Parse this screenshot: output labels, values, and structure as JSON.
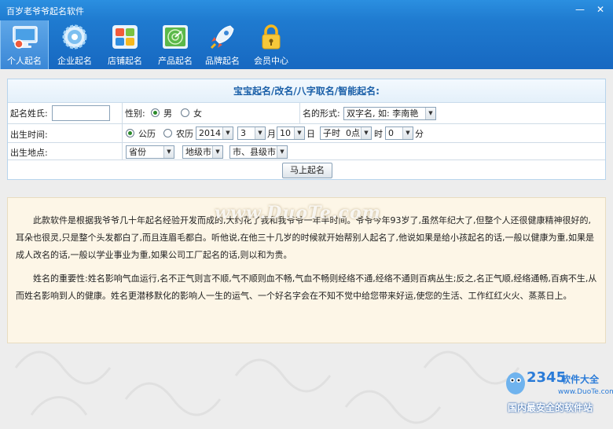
{
  "window": {
    "title": "百岁老爷爷起名软件",
    "min": "—",
    "close": "✕"
  },
  "toolbar": {
    "items": [
      {
        "label": "个人起名",
        "icon": "monitor-icon",
        "active": true
      },
      {
        "label": "企业起名",
        "icon": "gear-icon"
      },
      {
        "label": "店铺起名",
        "icon": "tiles-icon"
      },
      {
        "label": "产品起名",
        "icon": "radar-icon"
      },
      {
        "label": "品牌起名",
        "icon": "rocket-icon"
      },
      {
        "label": "会员中心",
        "icon": "lock-icon"
      }
    ]
  },
  "form": {
    "header": "宝宝起名/改名/八字取名/智能起名:",
    "surname_label": "起名姓氏:",
    "surname_value": "",
    "gender_label": "性别:",
    "gender_male": "男",
    "gender_female": "女",
    "gender_selected": "男",
    "name_form_label": "名的形式:",
    "name_form_value": "双字名, 如: 李南艳",
    "birth_time_label": "出生时间:",
    "solar_label": "公历",
    "lunar_label": "农历",
    "calendar_selected": "公历",
    "year": "2014",
    "month": "3",
    "month_unit": "月",
    "day": "10",
    "day_unit": "日",
    "shichen": "子时",
    "hour": "0点",
    "hour_unit": "时",
    "minute": "0",
    "minute_unit": "分",
    "birth_place_label": "出生地点:",
    "province": "省份",
    "city": "地级市",
    "county": "市、县级市",
    "submit": "马上起名"
  },
  "info": {
    "p1": "此款软件是根据我爷爷几十年起名经验开发而成的,大约花了我和我爷爷一年半时间。爷爷今年93岁了,虽然年纪大了,但整个人还很健康精神很好的,耳朵也很灵,只是整个头发都白了,而且连眉毛都白。听他说,在他三十几岁的时候就开始帮别人起名了,他说如果是给小孩起名的话,一般以健康为重,如果是成人改名的话,一般以学业事业为重,如果公司工厂起名的话,则以和为贵。",
    "p2": "姓名的重要性:姓名影响气血运行,名不正气则言不顺,气不顺则血不畅,气血不畅则经络不通,经络不通则百病丛生;反之,名正气顺,经络通畅,百病不生,从而姓名影响到人的健康。姓名更潜移默化的影响人一生的运气、一个好名字会在不知不觉中给您带来好运,使您的生活、工作红红火火、蒸蒸日上。"
  },
  "watermark": "www.DuoTe.com",
  "badge": {
    "num": "2345",
    "name": "软件大全",
    "url": "www.DuoTe.com",
    "slogan": "国内最安全的软件站"
  },
  "colors": {
    "title_bar": "#2b8fe0",
    "toolbar": "#1f7bd0",
    "header_text": "#1a5fa8",
    "info_bg": "#fdf6e7"
  }
}
